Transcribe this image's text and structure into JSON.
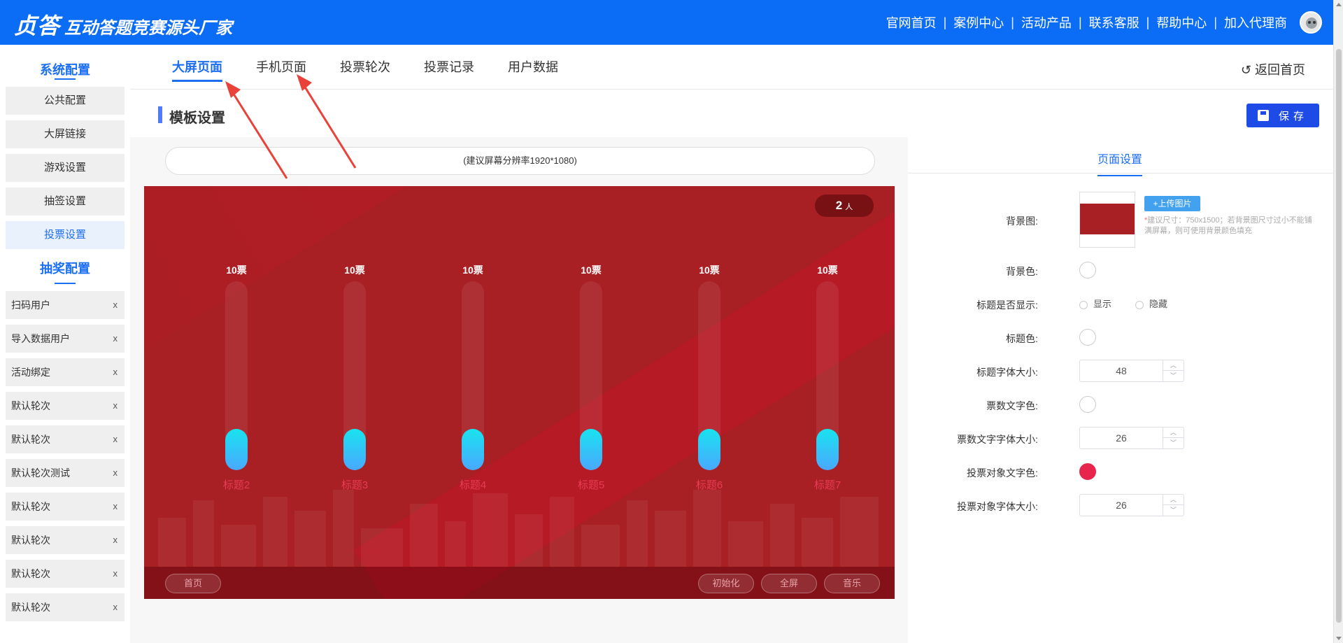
{
  "brand": {
    "logo": "贞答",
    "slogan": "互动答题竞赛源头厂家"
  },
  "topnav": [
    "官网首页",
    "案例中心",
    "活动产品",
    "联系客服",
    "帮助中心",
    "加入代理商"
  ],
  "topnav_sep": "|",
  "sidebar": {
    "heading1": "系统配置",
    "items1": [
      "公共配置",
      "大屏链接",
      "游戏设置",
      "抽签设置",
      "投票设置"
    ],
    "heading2": "抽奖配置",
    "items2": [
      "扫码用户",
      "导入数据用户",
      "活动绑定",
      "默认轮次",
      "默认轮次",
      "默认轮次测试",
      "默认轮次",
      "默认轮次",
      "默认轮次",
      "默认轮次"
    ],
    "close_symbol": "x"
  },
  "subnav": {
    "tabs": [
      "大屏页面",
      "手机页面",
      "投票轮次",
      "投票记录",
      "用户数据"
    ],
    "back": "↺ 返回首页"
  },
  "section": {
    "title": "模板设置",
    "save": "保存"
  },
  "preview": {
    "resolution": "(建议屏幕分辨率1920*1080)",
    "count": "2",
    "count_unit": "人",
    "bars": [
      {
        "votes": "10票",
        "label": "标题2",
        "fill": 0.22
      },
      {
        "votes": "10票",
        "label": "标题3",
        "fill": 0.22
      },
      {
        "votes": "10票",
        "label": "标题4",
        "fill": 0.22
      },
      {
        "votes": "10票",
        "label": "标题5",
        "fill": 0.22
      },
      {
        "votes": "10票",
        "label": "标题6",
        "fill": 0.22
      },
      {
        "votes": "10票",
        "label": "标题7",
        "fill": 0.22
      }
    ],
    "buttons": {
      "home": "首页",
      "init": "初始化",
      "fullscreen": "全屏",
      "music": "音乐"
    }
  },
  "settings": {
    "tab": "页面设置",
    "bg_image_label": "背景图:",
    "upload": "+上传图片",
    "upload_hint_star": "*",
    "upload_hint": "建议尺寸：750x1500；若背景图尺寸过小不能铺满屏幕，则可使用背景颜色填充",
    "bg_color_label": "背景色:",
    "title_show_label": "标题是否显示:",
    "show": "显示",
    "hide": "隐藏",
    "title_color_label": "标题色:",
    "title_font_label": "标题字体大小:",
    "title_font": "48",
    "vote_color_label": "票数文字色:",
    "vote_font_label": "票数文字字体大小:",
    "vote_font": "26",
    "target_color_label": "投票对象文字色:",
    "target_color": "#e8264d",
    "target_font_label": "投票对象字体大小:",
    "target_font": "26"
  },
  "colors": {
    "topbar": "#0b6cf5",
    "accent": "#1d6ff2",
    "screen_bg": "#a81f24",
    "save": "#1e4be6",
    "arrow": "#e8423a"
  }
}
